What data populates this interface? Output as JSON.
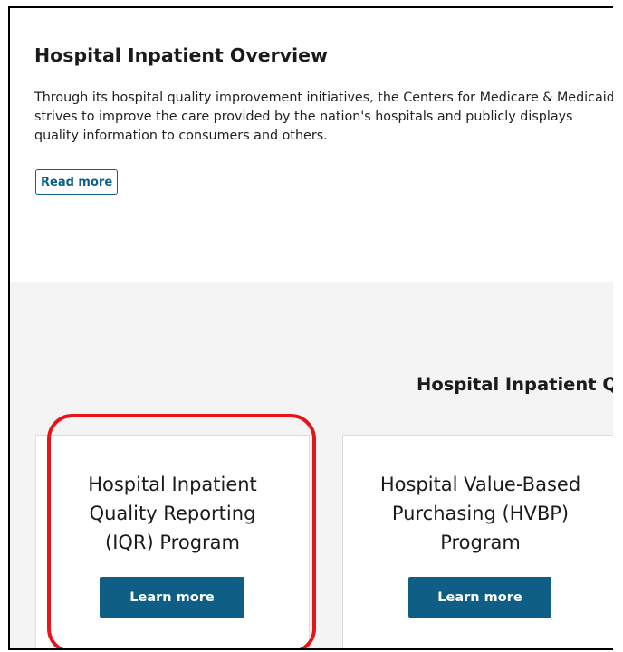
{
  "overview": {
    "title": "Hospital Inpatient Overview",
    "description_lines": [
      "Through its hospital quality improvement initiatives, the Centers for Medicare & Medicaid Services (CMS)",
      "strives to improve the care provided by the nation's hospitals and publicly displays",
      "quality information to consumers and others."
    ],
    "read_more_label": "Read more"
  },
  "programs": {
    "section_title": "Hospital Inpatient Quality Programs",
    "cards": [
      {
        "title_lines": [
          "Hospital Inpatient",
          "Quality Reporting",
          "(IQR) Program"
        ],
        "button_label": "Learn more"
      },
      {
        "title_lines": [
          "Hospital Value-Based",
          "Purchasing (HVBP)",
          "Program"
        ],
        "button_label": "Learn more"
      }
    ]
  },
  "colors": {
    "brand_blue": "#0e5e86",
    "section_gray": "#f4f4f4",
    "highlight_red": "#e8141a"
  }
}
